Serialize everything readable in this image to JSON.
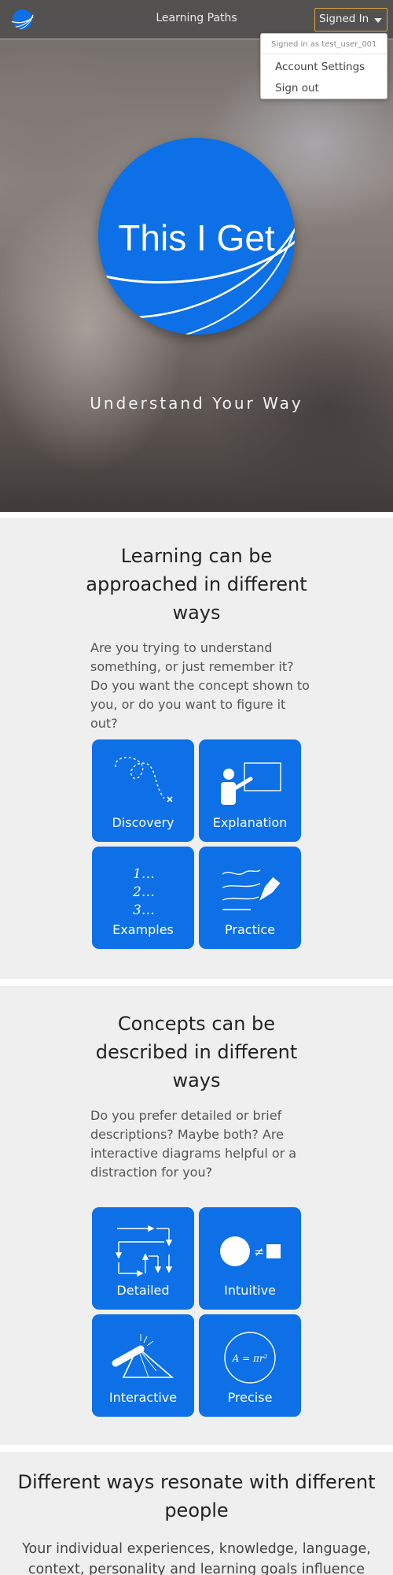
{
  "header": {
    "title": "Learning Paths",
    "signin_label": "Signed In",
    "dropdown": {
      "signed_in_as": "Signed in as test_user_001",
      "items": [
        "Account Settings",
        "Sign out"
      ]
    },
    "logo_icon": "globe-logo-icon"
  },
  "hero": {
    "logo_text": "This I Get",
    "tagline": "Understand Your Way"
  },
  "section1": {
    "title": "Learning can be approached in different ways",
    "body": "Are you trying to understand something, or just remember it? Do you want the concept shown to you, or do you want to figure it out?",
    "cards": [
      {
        "label": "Discovery",
        "icon": "dotted-path-icon"
      },
      {
        "label": "Explanation",
        "icon": "teacher-board-icon"
      },
      {
        "label": "Examples",
        "icon": "numbered-list-icon",
        "glyphs": [
          "1…",
          "2…",
          "3…"
        ]
      },
      {
        "label": "Practice",
        "icon": "pen-writing-icon"
      }
    ]
  },
  "section2": {
    "title": "Concepts can be described in different ways",
    "body": "Do you prefer detailed or brief descriptions? Maybe both? Are interactive diagrams helpful or a distraction for you?",
    "cards": [
      {
        "label": "Detailed",
        "icon": "flowchart-arrows-icon"
      },
      {
        "label": "Intuitive",
        "icon": "circle-not-equal-square-icon",
        "glyph": "≠"
      },
      {
        "label": "Interactive",
        "icon": "prism-icon"
      },
      {
        "label": "Precise",
        "icon": "formula-circle-icon",
        "glyph": "A = πr²"
      }
    ]
  },
  "section3": {
    "title": "Different ways resonate with different people",
    "body": "Your individual experiences, knowledge, language, context, personality and learning goals influence your"
  },
  "colors": {
    "brand_blue": "#0d70e6",
    "section_bg": "#efefef",
    "signin_border": "#d9a441"
  }
}
